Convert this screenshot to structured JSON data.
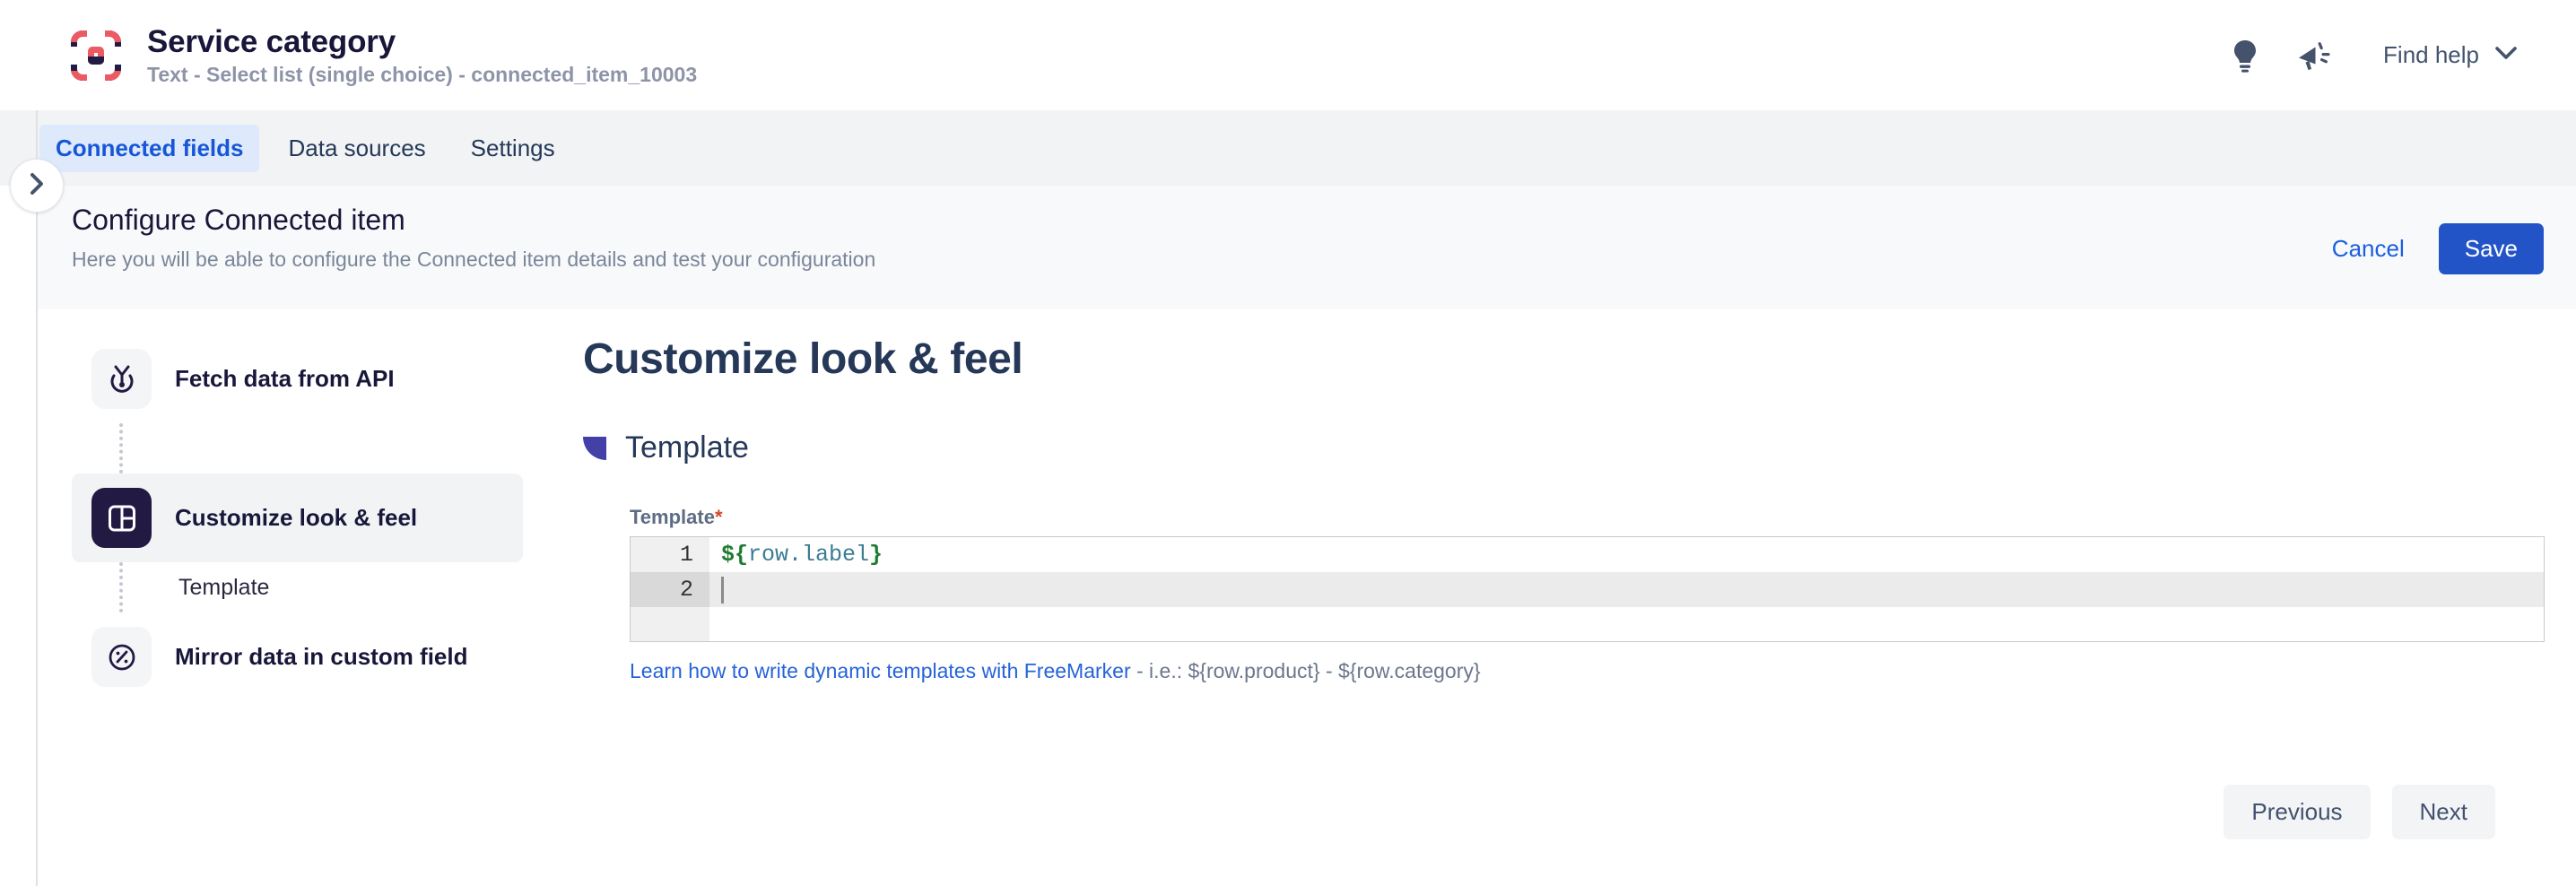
{
  "header": {
    "logo_icon": "connected-brackets-logo",
    "title": "Service category",
    "subtitle": "Text - Select list (single choice) - connected_item_10003",
    "tips_icon": "lightbulb-icon",
    "announcements_icon": "megaphone-icon",
    "find_help_label": "Find help",
    "find_help_chevron": "chevron-down-icon",
    "colors": {
      "logo_red": "#EC5B63",
      "logo_navy": "#221C44",
      "title": "#18173A",
      "subtitle": "#8D94A8"
    }
  },
  "tabs": {
    "items": [
      {
        "label": "Connected fields",
        "active": true
      },
      {
        "label": "Data sources",
        "active": false
      },
      {
        "label": "Settings",
        "active": false
      }
    ],
    "active_bg": "#DEE9FC",
    "active_fg": "#1757D6"
  },
  "collapse_button": {
    "icon": "chevron-right-icon"
  },
  "config": {
    "title": "Configure Connected item",
    "subtitle": "Here you will be able to configure the Connected item details and test your configuration",
    "cancel_label": "Cancel",
    "save_label": "Save",
    "save_bg": "#2354C7"
  },
  "steps": [
    {
      "label": "Fetch data from API",
      "icon": "api-fetch-icon",
      "active": false
    },
    {
      "label": "Customize look & feel",
      "icon": "layout-panel-icon",
      "active": true,
      "substeps": [
        {
          "label": "Template"
        }
      ]
    },
    {
      "label": "Mirror data in custom field",
      "icon": "mirror-circle-icon",
      "active": false
    }
  ],
  "main": {
    "heading": "Customize look & feel",
    "section": {
      "marker_icon": "section-marker-icon",
      "marker_color": "#4340A8",
      "title": "Template"
    },
    "template_field": {
      "label": "Template",
      "required_marker": "*",
      "lines": [
        {
          "number": "1",
          "prefix": "${",
          "property": "row.label",
          "suffix": "}",
          "active": false
        },
        {
          "number": "2",
          "prefix": "",
          "property": "",
          "suffix": "",
          "active": true
        }
      ]
    },
    "helper": {
      "link_text": "Learn how to write dynamic templates with FreeMarker",
      "suffix_text": " - i.e.: ${row.product} - ${row.category}"
    },
    "previous_label": "Previous",
    "next_label": "Next"
  }
}
